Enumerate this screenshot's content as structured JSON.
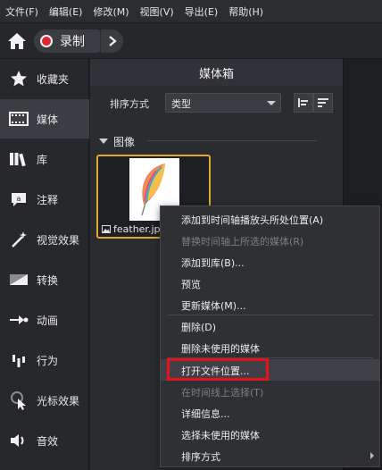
{
  "menubar": {
    "items": [
      "文件(F)",
      "编辑(E)",
      "修改(M)",
      "视图(V)",
      "导出(E)",
      "帮助(H)"
    ]
  },
  "toolbar": {
    "record_label": "录制",
    "icons": [
      "home-icon",
      "record-icon",
      "chevron-right-icon"
    ]
  },
  "sidebar": {
    "items": [
      {
        "label": "收藏夹",
        "icon": "star-icon"
      },
      {
        "label": "媒体",
        "icon": "film-icon",
        "active": true
      },
      {
        "label": "库",
        "icon": "library-icon"
      },
      {
        "label": "注释",
        "icon": "annotation-icon"
      },
      {
        "label": "视觉效果",
        "icon": "magic-wand-icon"
      },
      {
        "label": "转换",
        "icon": "transition-icon"
      },
      {
        "label": "动画",
        "icon": "animation-icon"
      },
      {
        "label": "行为",
        "icon": "behavior-icon"
      },
      {
        "label": "光标效果",
        "icon": "cursor-icon"
      },
      {
        "label": "音效",
        "icon": "audio-icon"
      }
    ]
  },
  "panel": {
    "title": "媒体箱",
    "sort_label": "排序方式",
    "sort_value": "类型",
    "section_label": "图像",
    "thumbnail": {
      "filename": "feather.jpg",
      "icon": "image-icon"
    }
  },
  "context_menu": {
    "items": [
      {
        "label": "添加到时间轴播放头所处位置(A)",
        "disabled": false
      },
      {
        "label": "替换时间轴上所选的媒体(R)",
        "disabled": true
      },
      {
        "label": "添加到库(B)...",
        "disabled": false
      },
      {
        "label": "预览",
        "disabled": false
      },
      {
        "label": "更新媒体(M)...",
        "disabled": false
      },
      {
        "label": "删除(D)",
        "disabled": false
      },
      {
        "label": "删除未使用的媒体",
        "disabled": false
      },
      {
        "label": "打开文件位置...",
        "disabled": false,
        "highlighted": true
      },
      {
        "label": "在时间线上选择(T)",
        "disabled": true
      },
      {
        "label": "详细信息...",
        "disabled": false
      },
      {
        "label": "选择未使用的媒体",
        "disabled": false
      },
      {
        "label": "排序方式",
        "disabled": false,
        "submenu": true
      }
    ]
  },
  "colors": {
    "accent_border": "#e0a92a",
    "record_red": "#e3242b",
    "highlight_red": "#e8111a"
  }
}
